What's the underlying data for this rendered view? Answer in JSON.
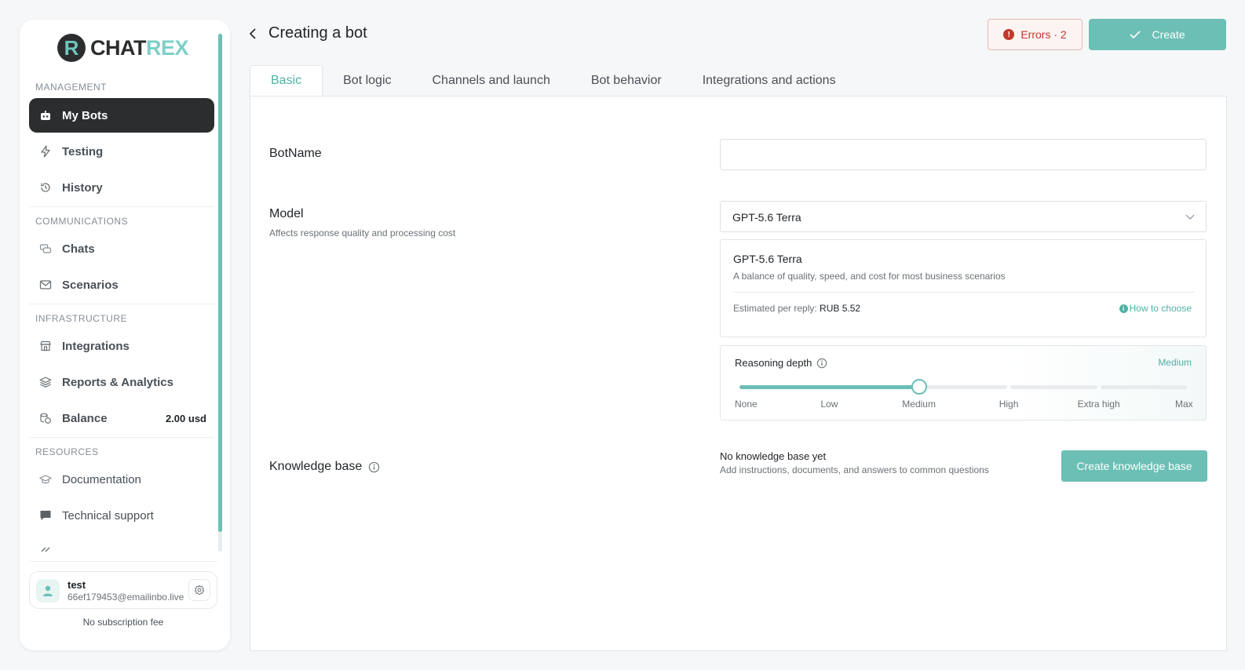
{
  "brand": {
    "mark": "R",
    "name_part1": "CHAT",
    "name_part2": "REX"
  },
  "sidebar": {
    "sections": {
      "management": "MANAGEMENT",
      "communications": "COMMUNICATIONS",
      "infrastructure": "INFRASTRUCTURE",
      "resources": "RESOURCES"
    },
    "items": {
      "my_bots": "My Bots",
      "testing": "Testing",
      "history": "History",
      "chats": "Chats",
      "scenarios": "Scenarios",
      "integrations": "Integrations",
      "reports": "Reports & Analytics",
      "balance": "Balance",
      "balance_value": "2.00 usd",
      "documentation": "Documentation",
      "support": "Technical support"
    },
    "user": {
      "name": "test",
      "email": "66ef179453@emailinbo.live",
      "subscription": "No subscription fee"
    }
  },
  "header": {
    "title": "Creating a bot",
    "errors_label": "Errors · 2",
    "create_label": "Create"
  },
  "tabs": [
    "Basic",
    "Bot logic",
    "Channels and launch",
    "Bot behavior",
    "Integrations and actions"
  ],
  "form": {
    "botname_label": "BotName",
    "botname_value": "",
    "model_label": "Model",
    "model_hint": "Affects response quality and processing cost",
    "model_selected": "GPT-5.6 Terra",
    "model_card": {
      "title": "GPT-5.6 Terra",
      "description": "A balance of quality, speed, and cost for most business scenarios",
      "estimate_prefix": "Estimated per reply: ",
      "estimate_value": "RUB 5.52",
      "how_to_choose": "How to choose"
    },
    "reasoning": {
      "title": "Reasoning depth",
      "current": "Medium",
      "levels": [
        "None",
        "Low",
        "Medium",
        "High",
        "Extra high",
        "Max"
      ],
      "level_fraction": 0.4
    },
    "knowledge": {
      "label": "Knowledge base",
      "status": "No knowledge base yet",
      "description": "Add instructions, documents, and answers to common questions",
      "button": "Create knowledge base"
    }
  },
  "colors": {
    "accent": "#6cbfb5",
    "accent_text": "#4fb1a5",
    "error": "#c0392b",
    "dark": "#2b2d2f"
  }
}
